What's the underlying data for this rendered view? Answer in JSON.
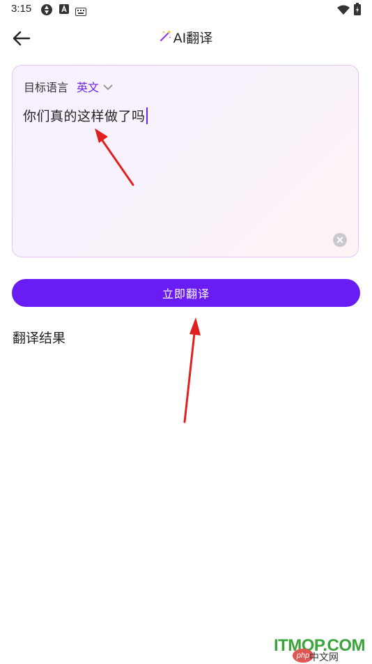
{
  "status_bar": {
    "time": "3:15",
    "icons": [
      "sync-icon",
      "font-a-icon",
      "keyboard-icon",
      "wifi-icon",
      "battery-icon"
    ]
  },
  "header": {
    "title": "AI翻译",
    "back_icon": "arrow-left-icon",
    "title_icon": "magic-wand-icon"
  },
  "input_card": {
    "target_lang_label": "目标语言",
    "target_lang_value": "英文",
    "input_text": "你们真的这样做了吗",
    "clear_icon": "clear-icon"
  },
  "translate_button": {
    "label": "立即翻译"
  },
  "result": {
    "label": "翻译结果"
  },
  "annotations": {
    "arrow_color": "#e0201f"
  },
  "watermark": {
    "main": "ITMOP.COM",
    "badge": "php",
    "sub": "中文网"
  },
  "colors": {
    "accent": "#6a1cf5",
    "card_border": "#e2c6f3",
    "link": "#6b21e8"
  }
}
